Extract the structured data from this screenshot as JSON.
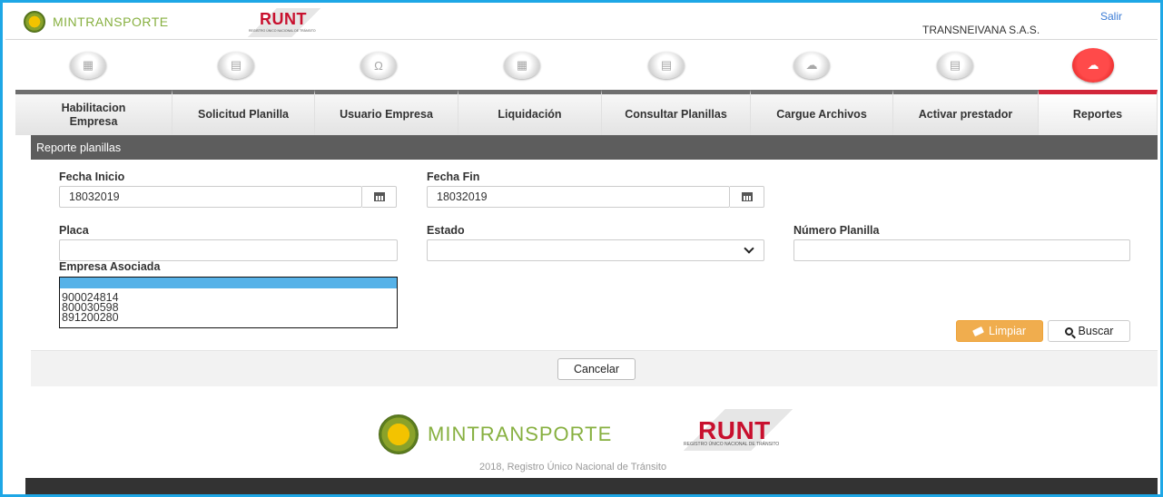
{
  "header": {
    "mintransporte_label": "MINTRANSPORTE",
    "runt_label": "RUNT",
    "runt_subtitle": "REGISTRO ÚNICO NACIONAL DE TRÁNSITO",
    "company_name": "TRANSNEIVANA S.A.S.",
    "logout_label": "Salir"
  },
  "nav": {
    "icons": [
      {
        "name": "building-icon",
        "glyph": "▦"
      },
      {
        "name": "document-icon",
        "glyph": "▤"
      },
      {
        "name": "user-icon",
        "glyph": "Ω"
      },
      {
        "name": "calculator-icon",
        "glyph": "▦"
      },
      {
        "name": "search-document-icon",
        "glyph": "▤"
      },
      {
        "name": "cloud-upload-icon",
        "glyph": "☁"
      },
      {
        "name": "document-check-icon",
        "glyph": "▤"
      },
      {
        "name": "cloud-upload-active-icon",
        "glyph": "☁"
      }
    ],
    "tabs": [
      {
        "label": "Habilitacion\nEmpresa"
      },
      {
        "label": "Solicitud Planilla"
      },
      {
        "label": "Usuario Empresa"
      },
      {
        "label": "Liquidación"
      },
      {
        "label": "Consultar Planillas"
      },
      {
        "label": "Cargue Archivos"
      },
      {
        "label": "Activar prestador"
      },
      {
        "label": "Reportes"
      }
    ],
    "active_index": 7
  },
  "panel": {
    "title": "Reporte planillas"
  },
  "form": {
    "fecha_inicio_label": "Fecha Inicio",
    "fecha_inicio_value": "18032019",
    "fecha_fin_label": "Fecha Fin",
    "fecha_fin_value": "18032019",
    "placa_label": "Placa",
    "placa_value": "",
    "estado_label": "Estado",
    "estado_value": "",
    "numero_planilla_label": "Número Planilla",
    "numero_planilla_value": "",
    "empresa_label": "Empresa Asociada",
    "empresa_options": [
      "900024814",
      "800030598",
      "891200280"
    ]
  },
  "actions": {
    "limpiar_label": "Limpiar",
    "buscar_label": "Buscar",
    "cancelar_label": "Cancelar"
  },
  "footer": {
    "mintransporte_label": "MINTRANSPORTE",
    "runt_label": "RUNT",
    "runt_subtitle": "REGISTRO ÚNICO NACIONAL DE TRÁNSITO",
    "copyright": "2018, Registro Único Nacional de Tránsito"
  },
  "colors": {
    "frame_border": "#1ea7e6",
    "active_tab_accent": "#d2263a",
    "panel_header": "#5d5d5d",
    "limpiar_button": "#f0ad4e",
    "listbox_selection": "#56b2e8"
  }
}
